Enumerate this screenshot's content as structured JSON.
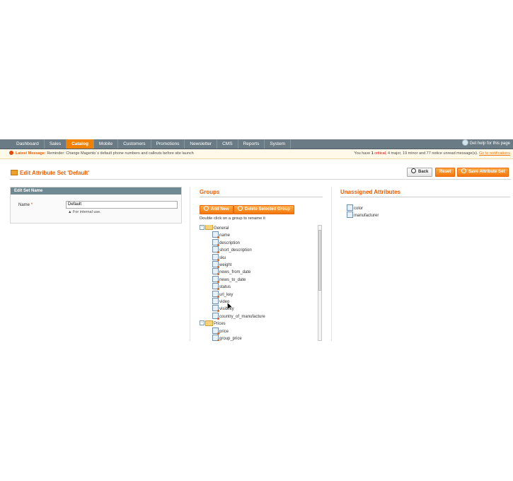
{
  "nav": {
    "items": [
      "Dashboard",
      "Sales",
      "Catalog",
      "Mobile",
      "Customers",
      "Promotions",
      "Newsletter",
      "CMS",
      "Reports",
      "System"
    ],
    "active": "Catalog",
    "help": "Get help for this page"
  },
  "message": {
    "label": "Latest Message:",
    "text": "Reminder: Change Magento`s default phone numbers and callouts before site launch",
    "summary_prefix": "You have",
    "critical_count": "1",
    "critical_label": "critical",
    "rest": ", 4 major, 19 minor and 77 notice unread message(s).",
    "link": "Go to notifications"
  },
  "page": {
    "title": "Edit Attribute Set 'Default'",
    "buttons": {
      "back": "Back",
      "reset": "Reset",
      "save": "Save Attribute Set"
    }
  },
  "edit_set": {
    "heading": "Edit Set Name",
    "name_label": "Name",
    "required_mark": "*",
    "name_value": "Default",
    "note": "For internal use."
  },
  "groups": {
    "title": "Groups",
    "add_new": "Add New",
    "delete": "Delete Selected Group",
    "hint": "Double click on a group to rename it",
    "tree": [
      {
        "label": "General",
        "type": "group"
      },
      {
        "label": "name",
        "type": "attr"
      },
      {
        "label": "description",
        "type": "attr"
      },
      {
        "label": "short_description",
        "type": "attr"
      },
      {
        "label": "sku",
        "type": "attr"
      },
      {
        "label": "weight",
        "type": "attr"
      },
      {
        "label": "news_from_date",
        "type": "attr"
      },
      {
        "label": "news_to_date",
        "type": "attr"
      },
      {
        "label": "status",
        "type": "attr"
      },
      {
        "label": "url_key",
        "type": "attr"
      },
      {
        "label": "video",
        "type": "attr"
      },
      {
        "label": "visibility",
        "type": "attr"
      },
      {
        "label": "country_of_manufacture",
        "type": "attr"
      },
      {
        "label": "Prices",
        "type": "group"
      },
      {
        "label": "price",
        "type": "attr"
      },
      {
        "label": "group_price",
        "type": "attr"
      }
    ]
  },
  "unassigned": {
    "title": "Unassigned Attributes",
    "items": [
      "color",
      "manufacturer"
    ]
  }
}
